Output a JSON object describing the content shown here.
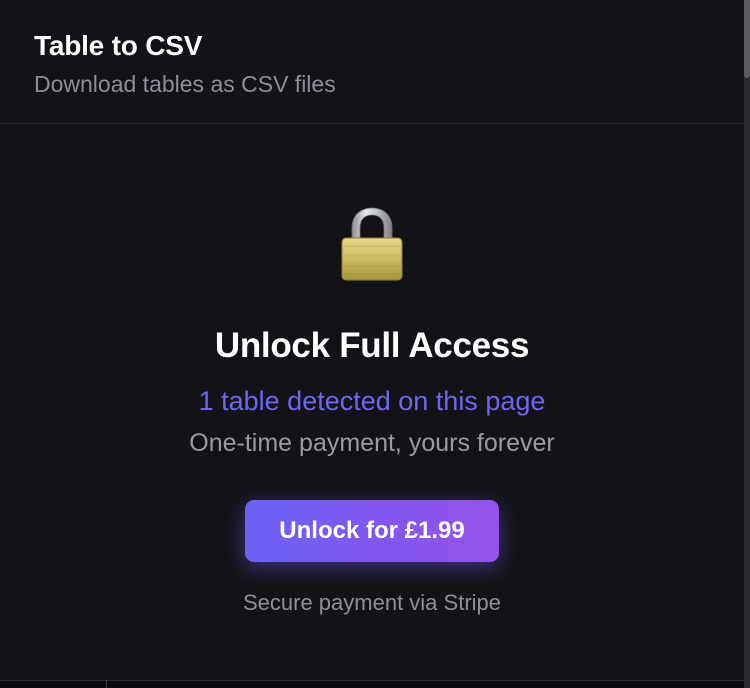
{
  "header": {
    "title": "Table to CSV",
    "subtitle": "Download tables as CSV files"
  },
  "main": {
    "icon": "lock-icon",
    "heading": "Unlock Full Access",
    "detected_text": "1 table detected on this page",
    "payment_note": "One-time payment, yours forever",
    "unlock_button_label": "Unlock for £1.99",
    "secure_note": "Secure payment via Stripe"
  },
  "colors": {
    "background": "#131317",
    "accent": "#6f66f0",
    "button_gradient_start": "#6c63f5",
    "button_gradient_end": "#9752ea",
    "muted_text": "#8e8e98"
  }
}
